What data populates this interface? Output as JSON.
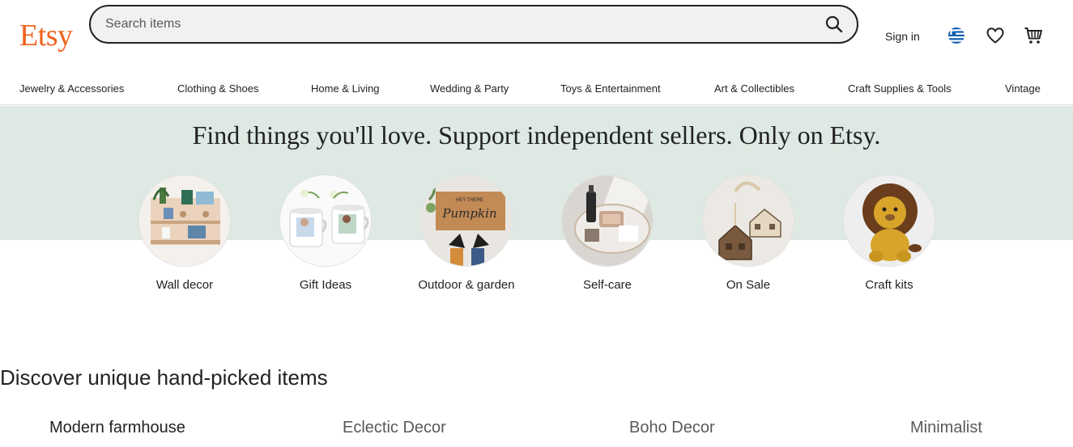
{
  "header": {
    "logo": "Etsy",
    "search": {
      "placeholder": "Search items",
      "value": ""
    },
    "signin": "Sign in",
    "icons": [
      "search-icon",
      "greek-flag-icon",
      "heart-icon",
      "cart-icon"
    ]
  },
  "nav": {
    "categories": [
      "Jewelry & Accessories",
      "Clothing & Shoes",
      "Home & Living",
      "Wedding & Party",
      "Toys & Entertainment",
      "Art & Collectibles",
      "Craft Supplies & Tools",
      "Vintage"
    ]
  },
  "hero": {
    "title": "Find things you'll love. Support independent sellers. Only on Etsy.",
    "items": [
      {
        "label": "Wall decor"
      },
      {
        "label": "Gift Ideas"
      },
      {
        "label": "Outdoor & garden"
      },
      {
        "label": "Self-care"
      },
      {
        "label": "On Sale"
      },
      {
        "label": "Craft kits"
      }
    ],
    "doormat_text_small": "HEY THERE",
    "doormat_text_big": "Pumpkin"
  },
  "discover": {
    "title": "Discover unique hand-picked items",
    "tabs": [
      {
        "label": "Modern farmhouse",
        "active": true
      },
      {
        "label": "Eclectic Decor",
        "active": false
      },
      {
        "label": "Boho Decor",
        "active": false
      },
      {
        "label": "Minimalist",
        "active": false
      }
    ]
  },
  "colors": {
    "brand": "#f1641e",
    "hero_bg": "#dde9e2",
    "text": "#222222",
    "muted": "#595959"
  }
}
